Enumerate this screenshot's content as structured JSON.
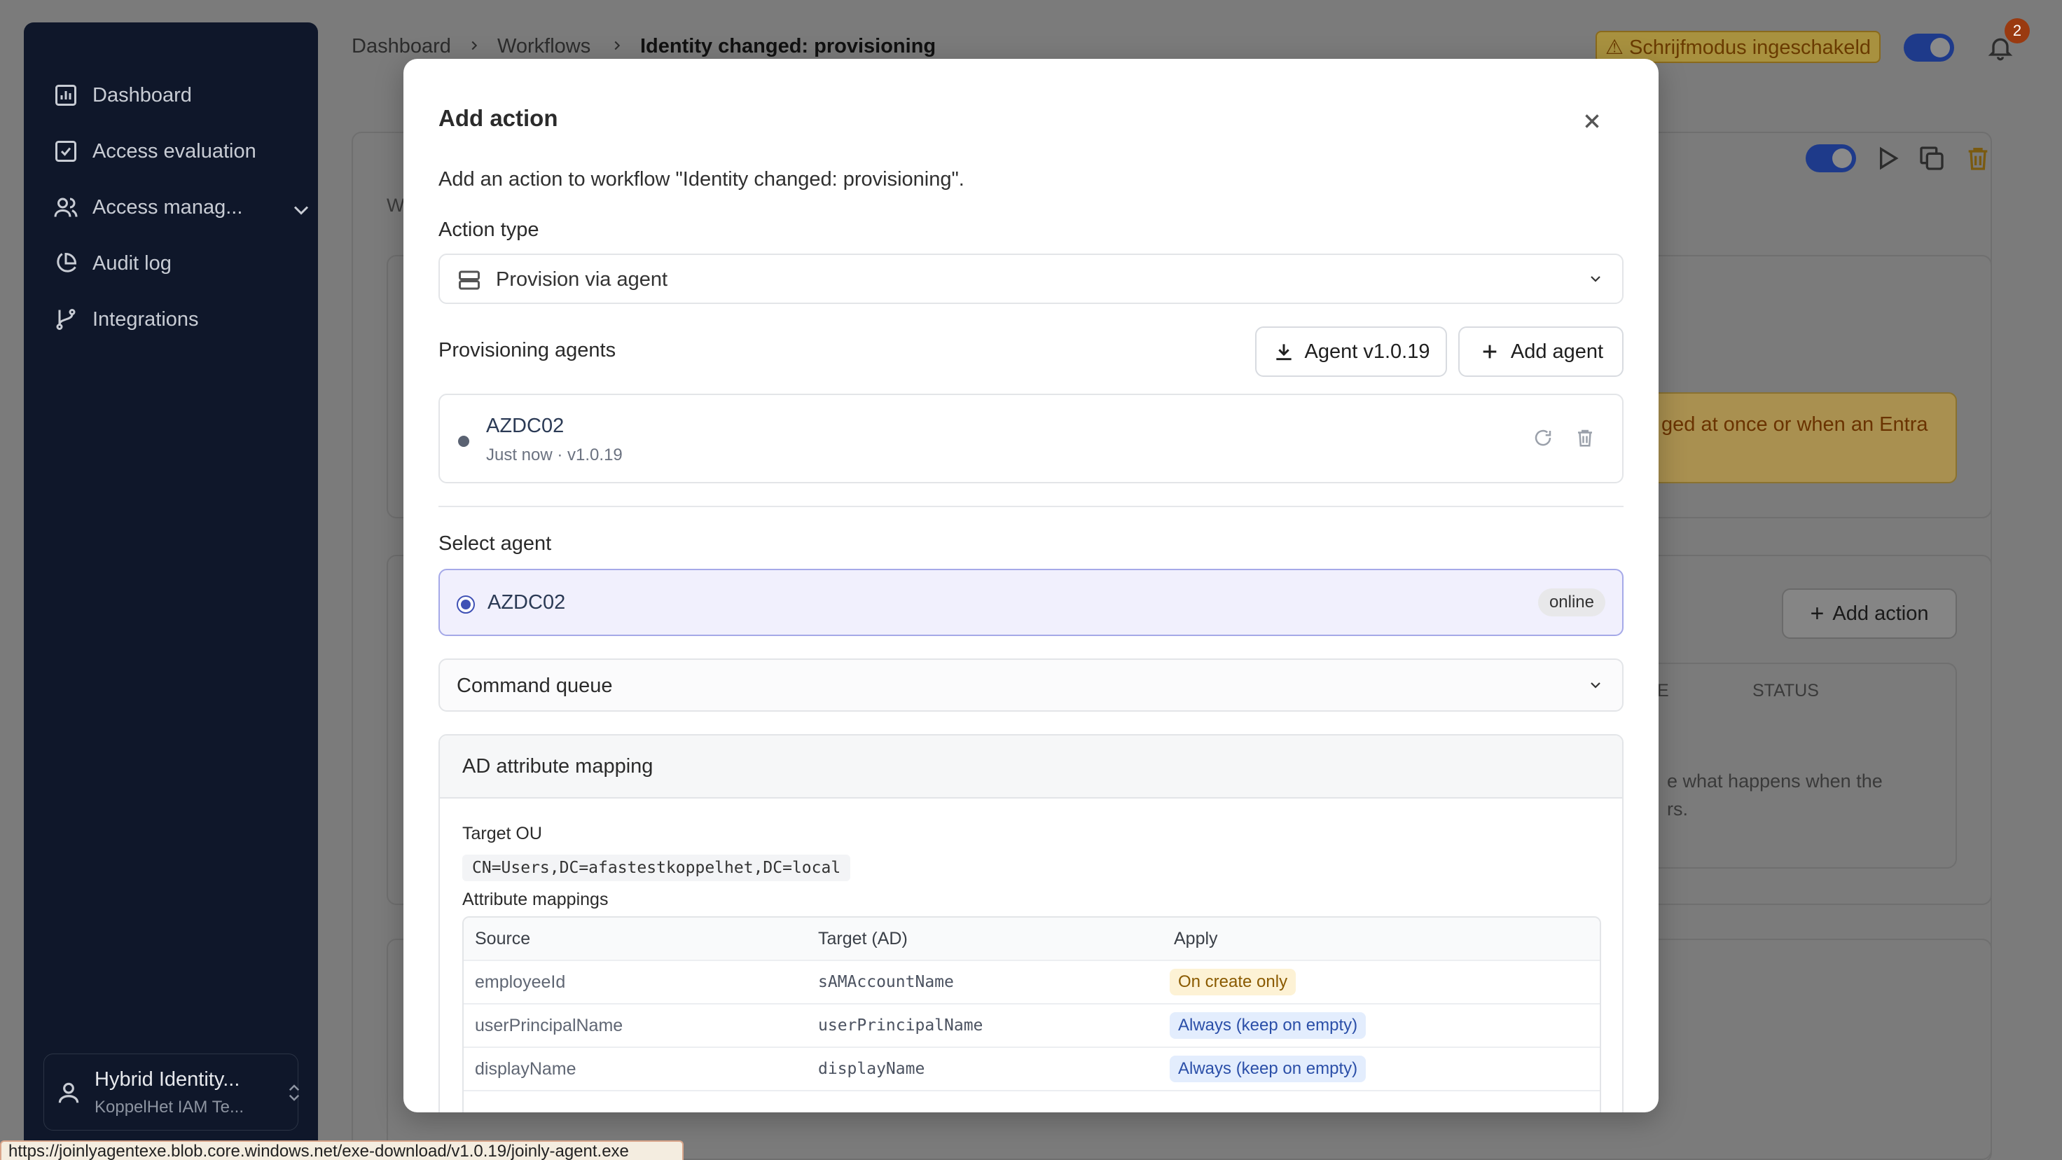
{
  "sidebar": {
    "items": [
      {
        "label": "Dashboard",
        "icon": "chart-icon"
      },
      {
        "label": "Access evaluation",
        "icon": "check-square-icon"
      },
      {
        "label": "Access manag...",
        "icon": "users-icon"
      },
      {
        "label": "Audit log",
        "icon": "pie-chart-icon"
      },
      {
        "label": "Integrations",
        "icon": "git-branch-icon"
      }
    ],
    "user": {
      "name": "Hybrid Identity...",
      "org": "KoppelHet IAM Te..."
    }
  },
  "breadcrumb": [
    "Dashboard",
    "Workflows",
    "Identity changed: provisioning"
  ],
  "header": {
    "write_mode": "⚠ Schrijfmodus ingeschakeld",
    "notification_count": "2"
  },
  "background": {
    "warning_text": "ged at once or when an Entra",
    "add_action": "Add action",
    "col_e": "E",
    "col_status": "STATUS",
    "empty_line1": "e what happens when the",
    "empty_line2": "rs.",
    "w_letter": "W"
  },
  "modal": {
    "title": "Add action",
    "description": "Add an action to workflow \"Identity changed: provisioning\".",
    "action_type_label": "Action type",
    "action_type_value": "Provision via agent",
    "agents_label": "Provisioning agents",
    "download_button": "Agent v1.0.19",
    "add_agent_button": "Add agent",
    "agent": {
      "name": "AZDC02",
      "meta": "Just now · v1.0.19"
    },
    "select_agent_label": "Select agent",
    "selected_agent": {
      "name": "AZDC02",
      "status": "online"
    },
    "command_queue": "Command queue",
    "mapping": {
      "title": "AD attribute mapping",
      "target_ou_label": "Target OU",
      "target_ou": "CN=Users,DC=afastestkoppelhet,DC=local",
      "mappings_label": "Attribute mappings",
      "columns": [
        "Source",
        "Target (AD)",
        "Apply"
      ],
      "rows": [
        {
          "source": "employeeId",
          "target": "sAMAccountName",
          "apply": "On create only",
          "kind": "create"
        },
        {
          "source": "userPrincipalName",
          "target": "userPrincipalName",
          "apply": "Always (keep on empty)",
          "kind": "always"
        },
        {
          "source": "displayName",
          "target": "displayName",
          "apply": "Always (keep on empty)",
          "kind": "always"
        }
      ]
    }
  },
  "status_url": "https://joinlyagentexe.blob.core.windows.net/exe-download/v1.0.19/joinly-agent.exe"
}
